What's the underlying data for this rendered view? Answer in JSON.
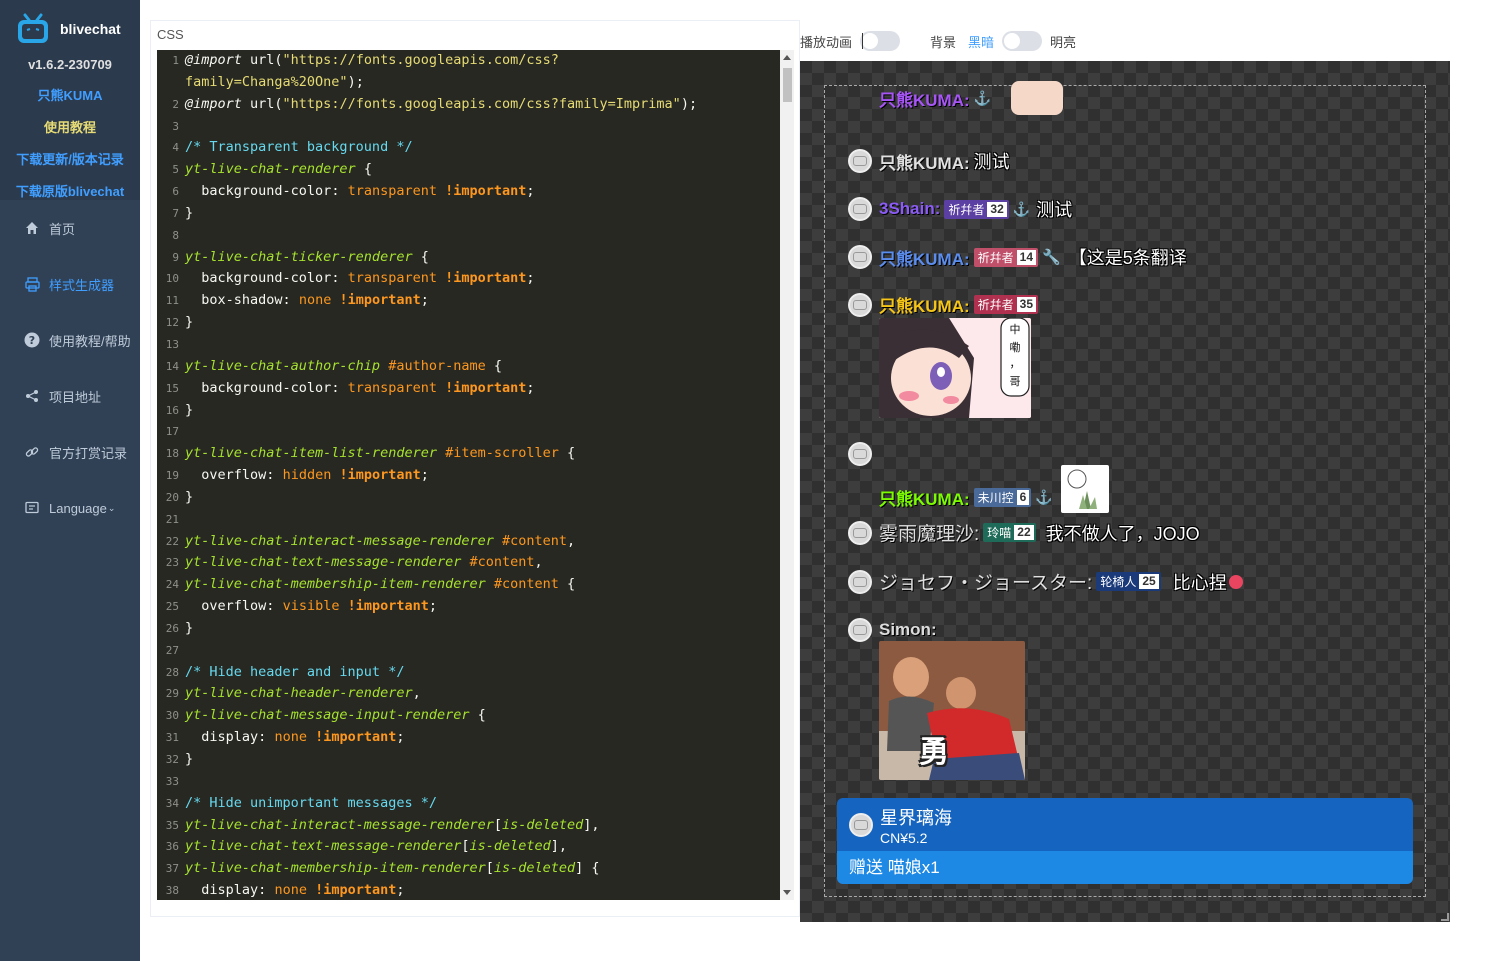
{
  "sidebar": {
    "app_name": "blivechat",
    "version": "v1.6.2-230709",
    "links": [
      {
        "label": "只熊KUMA",
        "color": "#409eff"
      },
      {
        "label": "使用教程",
        "color": "#e6db74"
      },
      {
        "label": "下载更新/版本记录",
        "color": "#409eff"
      },
      {
        "label": "下载原版blivechat",
        "color": "#409eff"
      }
    ],
    "nav": [
      {
        "label": "首页",
        "icon": "home-icon",
        "active": false
      },
      {
        "label": "样式生成器",
        "icon": "printer-icon",
        "active": true
      },
      {
        "label": "使用教程/帮助",
        "icon": "question-icon",
        "active": false
      },
      {
        "label": "项目地址",
        "icon": "share-icon",
        "active": false
      },
      {
        "label": "官方打赏记录",
        "icon": "link-icon",
        "active": false
      },
      {
        "label": "Language",
        "icon": "message-icon",
        "active": false
      }
    ]
  },
  "editor": {
    "label": "CSS"
  },
  "controls": {
    "animation_label": "播放动画",
    "background_label": "背景",
    "dark_label": "黑暗",
    "light_label": "明亮"
  },
  "preview": {
    "messages": [
      {
        "author": "只熊KUMA:",
        "author_color": "#a855f7",
        "text": ""
      },
      {
        "author": "只熊KUMA:",
        "author_color": "#e0e0e0",
        "text": "测试"
      },
      {
        "author": "3Shain:",
        "author_color": "#8b5cf6",
        "badge": "祈幷者",
        "badge_level": "32",
        "badge_color": "#5b3fa3",
        "text": "测试"
      },
      {
        "author": "只熊KUMA:",
        "author_color": "#5b8def",
        "badge": "祈幷者",
        "badge_level": "14",
        "badge_color": "#c0506a",
        "text": "【这是5条翻译"
      },
      {
        "author": "只熊KUMA:",
        "author_color": "#f5c518",
        "badge": "祈幷者",
        "badge_level": "35",
        "badge_color": "#b03050",
        "text": ""
      },
      {
        "author": "只熊KUMA:",
        "author_color": "#7cfc00",
        "badge": "未川控",
        "badge_level": "6",
        "badge_color": "#4a6a9a",
        "text": ""
      },
      {
        "author": "雾雨魔理沙:",
        "author_color": "#e0e0e0",
        "badge": "玲喵",
        "badge_level": "22",
        "badge_color": "#1f6b5a",
        "text": "我不做人了，JOJO"
      },
      {
        "author": "ジョセフ・ジョースター:",
        "author_color": "#e0e0e0",
        "badge": "轮椅人",
        "badge_level": "25",
        "badge_color": "#1a3a7a",
        "text": "比心捏"
      },
      {
        "author": "Simon:",
        "author_color": "#dddddd",
        "text": ""
      }
    ],
    "sticker_panel_text": [
      "中",
      "嘞",
      "，",
      "哥"
    ],
    "image_caption": "勇",
    "superchat": {
      "name": "星界璃海",
      "amount": "CN¥5.2",
      "message": "赠送 喵娘x1"
    }
  }
}
